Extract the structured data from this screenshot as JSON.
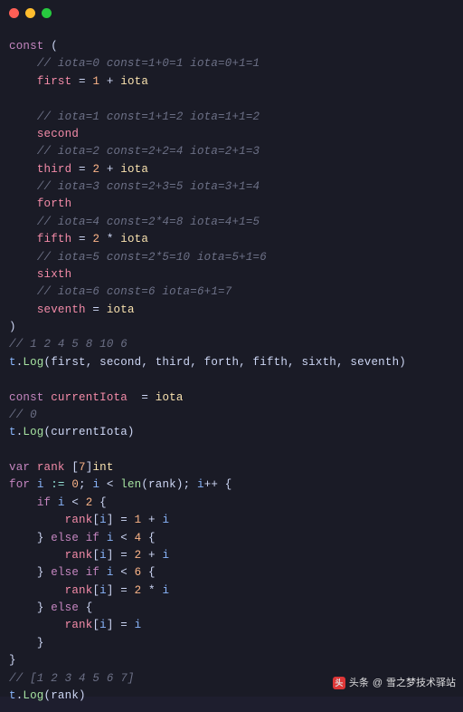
{
  "titlebar": {
    "dots": [
      "red",
      "yellow",
      "green"
    ]
  },
  "code": {
    "l01_kw": "const",
    "l01_paren": " (",
    "l02_indent": "    ",
    "l02_comment": "// iota=0 const=1+0=1 iota=0+1=1",
    "l03_indent": "    ",
    "l03_ident": "first",
    "l03_eq": " = ",
    "l03_num": "1",
    "l03_plus": " + ",
    "l03_iota": "iota",
    "l05_indent": "    ",
    "l05_comment": "// iota=1 const=1+1=2 iota=1+1=2",
    "l06_indent": "    ",
    "l06_ident": "second",
    "l07_indent": "    ",
    "l07_comment": "// iota=2 const=2+2=4 iota=2+1=3",
    "l08_indent": "    ",
    "l08_ident": "third",
    "l08_eq": " = ",
    "l08_num": "2",
    "l08_plus": " + ",
    "l08_iota": "iota",
    "l09_indent": "    ",
    "l09_comment": "// iota=3 const=2+3=5 iota=3+1=4",
    "l10_indent": "    ",
    "l10_ident": "forth",
    "l11_indent": "    ",
    "l11_comment": "// iota=4 const=2*4=8 iota=4+1=5",
    "l12_indent": "    ",
    "l12_ident": "fifth",
    "l12_eq": " = ",
    "l12_num": "2",
    "l12_op": " * ",
    "l12_iota": "iota",
    "l13_indent": "    ",
    "l13_comment": "// iota=5 const=2*5=10 iota=5+1=6",
    "l14_indent": "    ",
    "l14_ident": "sixth",
    "l15_indent": "    ",
    "l15_comment": "// iota=6 const=6 iota=6+1=7",
    "l16_indent": "    ",
    "l16_ident": "seventh",
    "l16_eq": " = ",
    "l16_iota": "iota",
    "l17_paren": ")",
    "l18_comment": "// 1 2 4 5 8 10 6",
    "l19_t": "t",
    "l19_dot": ".",
    "l19_func": "Log",
    "l19_args": "(first, second, third, forth, fifth, sixth, seventh)",
    "l21_kw": "const",
    "l21_sp": " ",
    "l21_ident": "currentIota",
    "l21_eq": "  = ",
    "l21_iota": "iota",
    "l22_comment": "// 0",
    "l23_t": "t",
    "l23_dot": ".",
    "l23_func": "Log",
    "l23_args": "(currentIota)",
    "l25_kw": "var",
    "l25_sp": " ",
    "l25_ident": "rank",
    "l25_sp2": " ",
    "l25_br": "[",
    "l25_num": "7",
    "l25_br2": "]",
    "l25_type": "int",
    "l26_kw": "for",
    "l26_sp": " ",
    "l26_i": "i",
    "l26_assign": " := ",
    "l26_num0": "0",
    "l26_semi": "; ",
    "l26_i2": "i",
    "l26_lt": " < ",
    "l26_len": "len",
    "l26_lp": "(rank); ",
    "l26_i3": "i",
    "l26_pp": "++ {",
    "l27_indent": "    ",
    "l27_kw": "if",
    "l27_sp": " ",
    "l27_i": "i",
    "l27_lt": " < ",
    "l27_num": "2",
    "l27_br": " {",
    "l28_indent": "        ",
    "l28_rank": "rank",
    "l28_br": "[",
    "l28_i": "i",
    "l28_br2": "] = ",
    "l28_num": "1",
    "l28_plus": " + ",
    "l28_i2": "i",
    "l29_indent": "    ",
    "l29_br": "} ",
    "l29_kw": "else if",
    "l29_sp": " ",
    "l29_i": "i",
    "l29_lt": " < ",
    "l29_num": "4",
    "l29_br2": " {",
    "l30_indent": "        ",
    "l30_rank": "rank",
    "l30_br": "[",
    "l30_i": "i",
    "l30_br2": "] = ",
    "l30_num": "2",
    "l30_plus": " + ",
    "l30_i2": "i",
    "l31_indent": "    ",
    "l31_br": "} ",
    "l31_kw": "else if",
    "l31_sp": " ",
    "l31_i": "i",
    "l31_lt": " < ",
    "l31_num": "6",
    "l31_br2": " {",
    "l32_indent": "        ",
    "l32_rank": "rank",
    "l32_br": "[",
    "l32_i": "i",
    "l32_br2": "] = ",
    "l32_num": "2",
    "l32_op": " * ",
    "l32_i2": "i",
    "l33_indent": "    ",
    "l33_br": "} ",
    "l33_kw": "else",
    "l33_br2": " {",
    "l34_indent": "        ",
    "l34_rank": "rank",
    "l34_br": "[",
    "l34_i": "i",
    "l34_br2": "] = ",
    "l34_i2": "i",
    "l35_indent": "    ",
    "l35_br": "}",
    "l36_br": "}",
    "l37_comment": "// [1 2 3 4 5 6 7]",
    "l38_t": "t",
    "l38_dot": ".",
    "l38_func": "Log",
    "l38_args": "(rank)"
  },
  "watermark": {
    "prefix": "头条",
    "at": "@",
    "author": "雪之梦技术驿站"
  }
}
